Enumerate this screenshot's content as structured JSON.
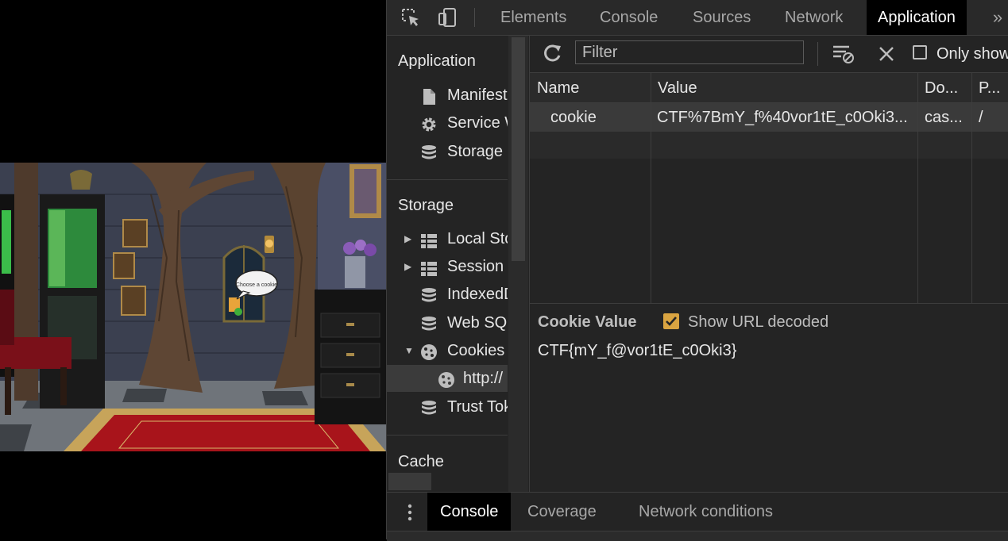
{
  "devtools": {
    "tabs": [
      {
        "label": "Elements",
        "active": false
      },
      {
        "label": "Console",
        "active": false
      },
      {
        "label": "Sources",
        "active": false
      },
      {
        "label": "Network",
        "active": false
      },
      {
        "label": "Application",
        "active": true
      }
    ],
    "more_tabs": "»"
  },
  "sidebar": {
    "application_heading": "Application",
    "application_items": [
      {
        "label": "Manifest",
        "icon": "document-icon"
      },
      {
        "label": "Service Workers",
        "icon": "gear-icon"
      },
      {
        "label": "Storage",
        "icon": "database-icon"
      }
    ],
    "storage_heading": "Storage",
    "storage_items": [
      {
        "label": "Local Storage",
        "icon": "grid-icon",
        "expander": "▶"
      },
      {
        "label": "Session Storage",
        "icon": "grid-icon",
        "expander": "▶"
      },
      {
        "label": "IndexedDB",
        "icon": "database-icon"
      },
      {
        "label": "Web SQL",
        "icon": "database-icon"
      },
      {
        "label": "Cookies",
        "icon": "cookie-icon",
        "expander": "▼"
      },
      {
        "label": "http://",
        "icon": "cookie-icon",
        "selected": true
      },
      {
        "label": "Trust Tokens",
        "icon": "database-icon"
      }
    ],
    "cache_heading": "Cache"
  },
  "main": {
    "filter_placeholder": "Filter",
    "only_show_label": "Only show",
    "columns": [
      "Name",
      "Value",
      "Do...",
      "P..."
    ],
    "rows": [
      {
        "name": "cookie",
        "value": "CTF%7BmY_f%40vor1tE_c0Oki3...",
        "domain": "cas...",
        "path": "/"
      }
    ],
    "cookie_value_title": "Cookie Value",
    "show_url_decoded_label": "Show URL decoded",
    "show_url_decoded": true,
    "cookie_value_text": "CTF{mY_f@vor1tE_c0Oki3}"
  },
  "drawer": {
    "tabs": [
      {
        "label": "Console",
        "active": true
      },
      {
        "label": "Coverage",
        "active": false
      },
      {
        "label": "Network conditions",
        "active": false
      }
    ]
  },
  "webpage": {
    "speech_bubble_text": "Choose a cookie"
  },
  "colors": {
    "devtools_bg": "#242424",
    "active_tab_bg": "#000000",
    "checkbox_accent": "#d9a441"
  }
}
